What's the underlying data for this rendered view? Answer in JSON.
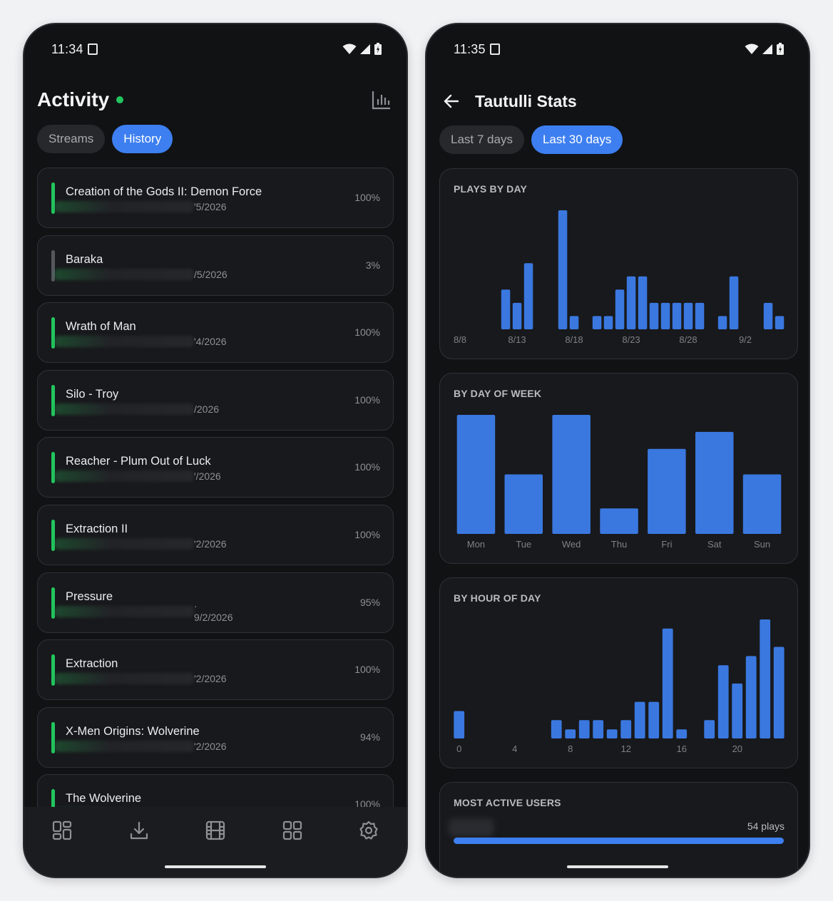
{
  "left": {
    "status": {
      "time": "11:34"
    },
    "header": {
      "title": "Activity"
    },
    "tabs": [
      {
        "label": "Streams",
        "active": false
      },
      {
        "label": "History",
        "active": true
      }
    ],
    "history": [
      {
        "title": "Creation of the Gods II: Demon Force",
        "date": "'5/2026",
        "progress": "100%",
        "status": "complete"
      },
      {
        "title": "Baraka",
        "date": "/5/2026",
        "progress": "3%",
        "status": "partial"
      },
      {
        "title": "Wrath of Man",
        "date": "'4/2026",
        "progress": "100%",
        "status": "complete"
      },
      {
        "title": "Silo - Troy",
        "date": "/2026",
        "progress": "100%",
        "status": "complete"
      },
      {
        "title": "Reacher - Plum Out of Luck",
        "date": "'/2026",
        "progress": "100%",
        "status": "complete"
      },
      {
        "title": "Extraction II",
        "date": "'2/2026",
        "progress": "100%",
        "status": "complete"
      },
      {
        "title": "Pressure",
        "date": "· 9/2/2026",
        "progress": "95%",
        "status": "complete"
      },
      {
        "title": "Extraction",
        "date": "'2/2026",
        "progress": "100%",
        "status": "complete"
      },
      {
        "title": "X-Men Origins: Wolverine",
        "date": "'2/2026",
        "progress": "94%",
        "status": "complete"
      },
      {
        "title": "The Wolverine",
        "date": "",
        "progress": "100%",
        "status": "complete"
      }
    ],
    "nav": [
      "dashboard-icon",
      "download-icon",
      "film-icon",
      "apps-icon",
      "settings-icon"
    ]
  },
  "right": {
    "status": {
      "time": "11:35"
    },
    "header": {
      "title": "Tautulli Stats"
    },
    "tabs": [
      {
        "label": "Last 7 days",
        "active": false
      },
      {
        "label": "Last 30 days",
        "active": true
      }
    ],
    "cards": {
      "plays_by_day": "PLAYS BY DAY",
      "by_day_of_week": "BY DAY OF WEEK",
      "by_hour_of_day": "BY HOUR OF DAY",
      "most_active_users": "MOST ACTIVE USERS"
    },
    "top_user": {
      "plays_label": "54 plays",
      "fraction": 1.0
    }
  },
  "colors": {
    "accent": "#3d7ff0",
    "live": "#22c55e",
    "bar": "#3a78e0",
    "bg": "#111214",
    "card": "#18191c"
  },
  "chart_data": [
    {
      "type": "bar",
      "title": "PLAYS BY DAY",
      "categories": [
        "8/8",
        "8/9",
        "8/10",
        "8/11",
        "8/12",
        "8/13",
        "8/14",
        "8/15",
        "8/16",
        "8/17",
        "8/18",
        "8/19",
        "8/20",
        "8/21",
        "8/22",
        "8/23",
        "8/24",
        "8/25",
        "8/26",
        "8/27",
        "8/28",
        "8/29",
        "8/30",
        "8/31",
        "9/1",
        "9/2",
        "9/3",
        "9/4",
        "9/5"
      ],
      "values": [
        0,
        0,
        0,
        0,
        3,
        2,
        5,
        0,
        0,
        9,
        1,
        0,
        1,
        1,
        3,
        4,
        4,
        2,
        2,
        2,
        2,
        2,
        0,
        1,
        4,
        0,
        0,
        2,
        1
      ],
      "tick_labels": [
        "8/8",
        "8/13",
        "8/18",
        "8/23",
        "8/28",
        "9/2"
      ],
      "ylim": [
        0,
        9
      ]
    },
    {
      "type": "bar",
      "title": "BY DAY OF WEEK",
      "categories": [
        "Mon",
        "Tue",
        "Wed",
        "Thu",
        "Fri",
        "Sat",
        "Sun"
      ],
      "values": [
        14,
        7,
        14,
        3,
        10,
        12,
        7
      ],
      "ylim": [
        0,
        14
      ]
    },
    {
      "type": "bar",
      "title": "BY HOUR OF DAY",
      "categories": [
        "0",
        "1",
        "2",
        "3",
        "4",
        "5",
        "6",
        "7",
        "8",
        "9",
        "10",
        "11",
        "12",
        "13",
        "14",
        "15",
        "16",
        "17",
        "18",
        "19",
        "20",
        "21",
        "22",
        "23"
      ],
      "values": [
        3,
        0,
        0,
        0,
        0,
        0,
        0,
        2,
        1,
        2,
        2,
        1,
        2,
        4,
        4,
        12,
        1,
        0,
        2,
        8,
        6,
        9,
        13,
        10
      ],
      "tick_labels": [
        "0",
        "4",
        "8",
        "12",
        "16",
        "20"
      ],
      "ylim": [
        0,
        13
      ]
    }
  ]
}
